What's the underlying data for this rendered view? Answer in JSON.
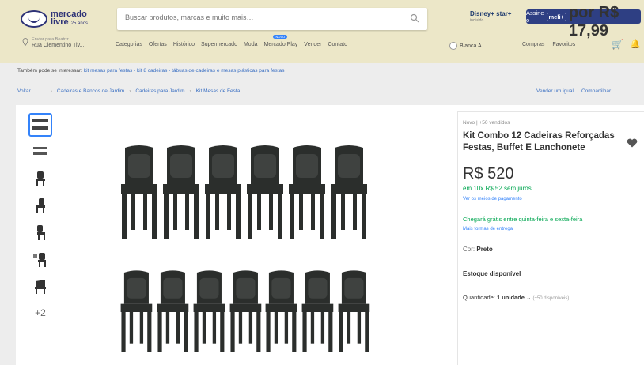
{
  "header": {
    "logo_line1": "mercado",
    "logo_line2": "livre",
    "logo_sub": "25 anos",
    "search_placeholder": "Buscar produtos, marcas e muito mais…",
    "disney_label": "Disney+ star+",
    "disney_sub": "incluído",
    "promo_text": "Assine o",
    "promo_badge": "meli+",
    "promo_price": "por R$ 17,99",
    "address_line1": "Enviar para Beatriz",
    "address_line2": "Rua Clementino Tiv...",
    "nav": [
      "Categorias",
      "Ofertas",
      "Histórico",
      "Supermercado",
      "Moda",
      "Mercado Play",
      "Vender",
      "Contato"
    ],
    "user": "Bianca A.",
    "right_nav": [
      "Compras",
      "Favoritos"
    ]
  },
  "related": {
    "label": "Também pode se interessar:",
    "links": "kit mesas para festas - kit 8 cadeiras - tábuas de cadeiras e mesas plásticas para festas"
  },
  "breadcrumb": [
    "Voltar",
    "...",
    "Cadeiras e Bancos de Jardim",
    "Cadeiras para Jardim",
    "Kit Mesas de Festa"
  ],
  "breadcrumb_right": [
    "Vender um igual",
    "Compartilhar"
  ],
  "product": {
    "condition": "Novo | +50 vendidos",
    "title": "Kit Combo 12 Cadeiras Reforçadas Festas, Buffet E Lanchonete",
    "price": "R$ 520",
    "installments": "em 10x R$ 52 sem juros",
    "payment_link": "Ver os meios de pagamento",
    "shipping": "Chegará grátis entre quinta-feira e sexta-feira",
    "shipping_link": "Mais formas de entrega",
    "color_label": "Cor:",
    "color_value": "Preto",
    "stock": "Estoque disponível",
    "qty_label": "Quantidade:",
    "qty_value": "1 unidade",
    "qty_available": "(+50 disponíveis)",
    "more_thumbs": "+2"
  },
  "colors": {
    "header_bg": "#ece7c8",
    "brand_blue": "#2d3277",
    "link_blue": "#3483fa",
    "green": "#00a650",
    "chair": "#2b2e2c"
  }
}
